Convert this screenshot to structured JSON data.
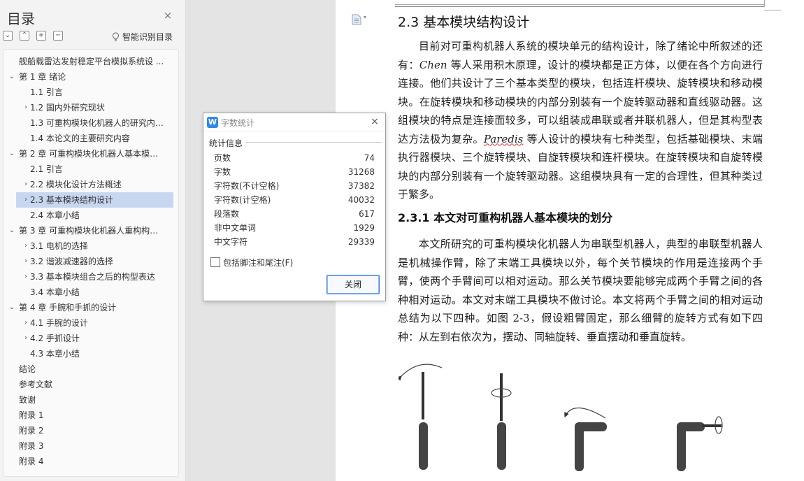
{
  "nav": {
    "title": "目录",
    "close_glyph": "×",
    "smart_toc_label": "智能识别目录",
    "toolbar": [
      "⌄",
      "⌃",
      "+",
      "−"
    ],
    "items": [
      {
        "label": "舰船载雷达发射稳定平台模拟系统设 ...",
        "level": 0,
        "chevron": ""
      },
      {
        "label": "第 1 章  绪论",
        "level": 0,
        "chevron": "⌄"
      },
      {
        "label": "1.1  引言",
        "level": 1,
        "chevron": ""
      },
      {
        "label": "1.2  国内外研究现状",
        "level": 1,
        "chevron": "›"
      },
      {
        "label": "1.3  可重构模块化机器人的研究内 ...",
        "level": 1,
        "chevron": ""
      },
      {
        "label": "1.4  本论文的主要研究内容",
        "level": 1,
        "chevron": ""
      },
      {
        "label": "第 2 章  可重构模块化机器人基本模块 ...",
        "level": 0,
        "chevron": "⌄"
      },
      {
        "label": "2.1  引言",
        "level": 1,
        "chevron": ""
      },
      {
        "label": "2.2  模块化设计方法概述",
        "level": 1,
        "chevron": "›"
      },
      {
        "label": "2.3  基本模块结构设计",
        "level": 1,
        "chevron": "›",
        "active": true
      },
      {
        "label": "2.4  本章小结",
        "level": 1,
        "chevron": ""
      },
      {
        "label": "第 3 章  可重构模块化机器人重构构型 ...",
        "level": 0,
        "chevron": "⌄"
      },
      {
        "label": "3.1  电机的选择",
        "level": 1,
        "chevron": "›"
      },
      {
        "label": "3.2  谐波减速器的选择",
        "level": 1,
        "chevron": "›"
      },
      {
        "label": "3.3  基本模块组合之后的构型表达",
        "level": 1,
        "chevron": "›"
      },
      {
        "label": "3.4  本章小结",
        "level": 1,
        "chevron": ""
      },
      {
        "label": "第 4 章  手腕和手抓的设计",
        "level": 0,
        "chevron": "⌄"
      },
      {
        "label": "4.1  手腕的设计",
        "level": 1,
        "chevron": "›"
      },
      {
        "label": "4.2  手抓设计",
        "level": 1,
        "chevron": "›"
      },
      {
        "label": "4.3  本章小结",
        "level": 1,
        "chevron": ""
      },
      {
        "label": "结论",
        "level": 0,
        "chevron": ""
      },
      {
        "label": "参考文献",
        "level": 0,
        "chevron": ""
      },
      {
        "label": "致谢",
        "level": 0,
        "chevron": ""
      },
      {
        "label": "附录 1",
        "level": 0,
        "chevron": ""
      },
      {
        "label": "附录 2",
        "level": 0,
        "chevron": ""
      },
      {
        "label": "附录 3",
        "level": 0,
        "chevron": ""
      },
      {
        "label": "附录 4",
        "level": 0,
        "chevron": ""
      }
    ]
  },
  "doc": {
    "section_heading": "2.3  基本模块结构设计",
    "para1_a": "目前对可重构机器人系统的模块单元的结构设计，除了绪论中所叙述的还有：",
    "para1_chen": "Chen",
    "para1_b": " 等人采用积木原理，设计的模块都是正方体，以便在各个方向进行连接。他们共设计了三个基本类型的模块，包括连杆模块、旋转模块和移动模块。在旋转模块和移动模块的内部分别装有一个旋转驱动器和直线驱动器。这组模块的特点是连接面较多，可以组装成串联或者并联机器人，但是其构型表达方法极为复杂。",
    "para1_paredis": "Paredis",
    "para1_c": " 等人设计的模块有七种类型，包括基础模块、末端执行器模块、三个旋转模块、自旋转模块和连杆模块。在旋转模块和自旋转模块的内部分别装有一个旋转驱动器。这组模块具有一定的合理性，但其种类过于繁多。",
    "sub_heading": "2.3.1  本文对可重构机器人基本模块的划分",
    "para2": "本文所研究的可重构模块化机器人为串联型机器人，典型的串联型机器人是机械操作臂，除了末端工具模块以外，每个关节模块的作用是连接两个手臂，使两个手臂间可以相对运动。那么关节模块要能够完成两个手臂之间的各种相对运动。本文对末端工具模块不做讨论。本文将两个手臂之间的相对运动总结为以下四种。如图 2-3，假设粗臂固定，那么细臂的旋转方式有如下四种：从左到右依次为，摆动、同轴旋转、垂直摆动和垂直旋转。"
  },
  "dialog": {
    "title": "字数统计",
    "logo": "W",
    "close_glyph": "×",
    "section": "统计信息",
    "stats": [
      {
        "label": "页数",
        "value": "74"
      },
      {
        "label": "字数",
        "value": "31268"
      },
      {
        "label": "字符数(不计空格)",
        "value": "37382"
      },
      {
        "label": "字符数(计空格)",
        "value": "40032"
      },
      {
        "label": "段落数",
        "value": "617"
      },
      {
        "label": "非中文单词",
        "value": "1929"
      },
      {
        "label": "中文字符",
        "value": "29339"
      }
    ],
    "checkbox_label": "包括脚注和尾注(F)",
    "checkbox_checked": false,
    "ok_label": "关闭"
  },
  "colors": {
    "accent": "#2f8ae5",
    "toc_active": "#c8d7f0",
    "button_border": "#3b7de0"
  }
}
